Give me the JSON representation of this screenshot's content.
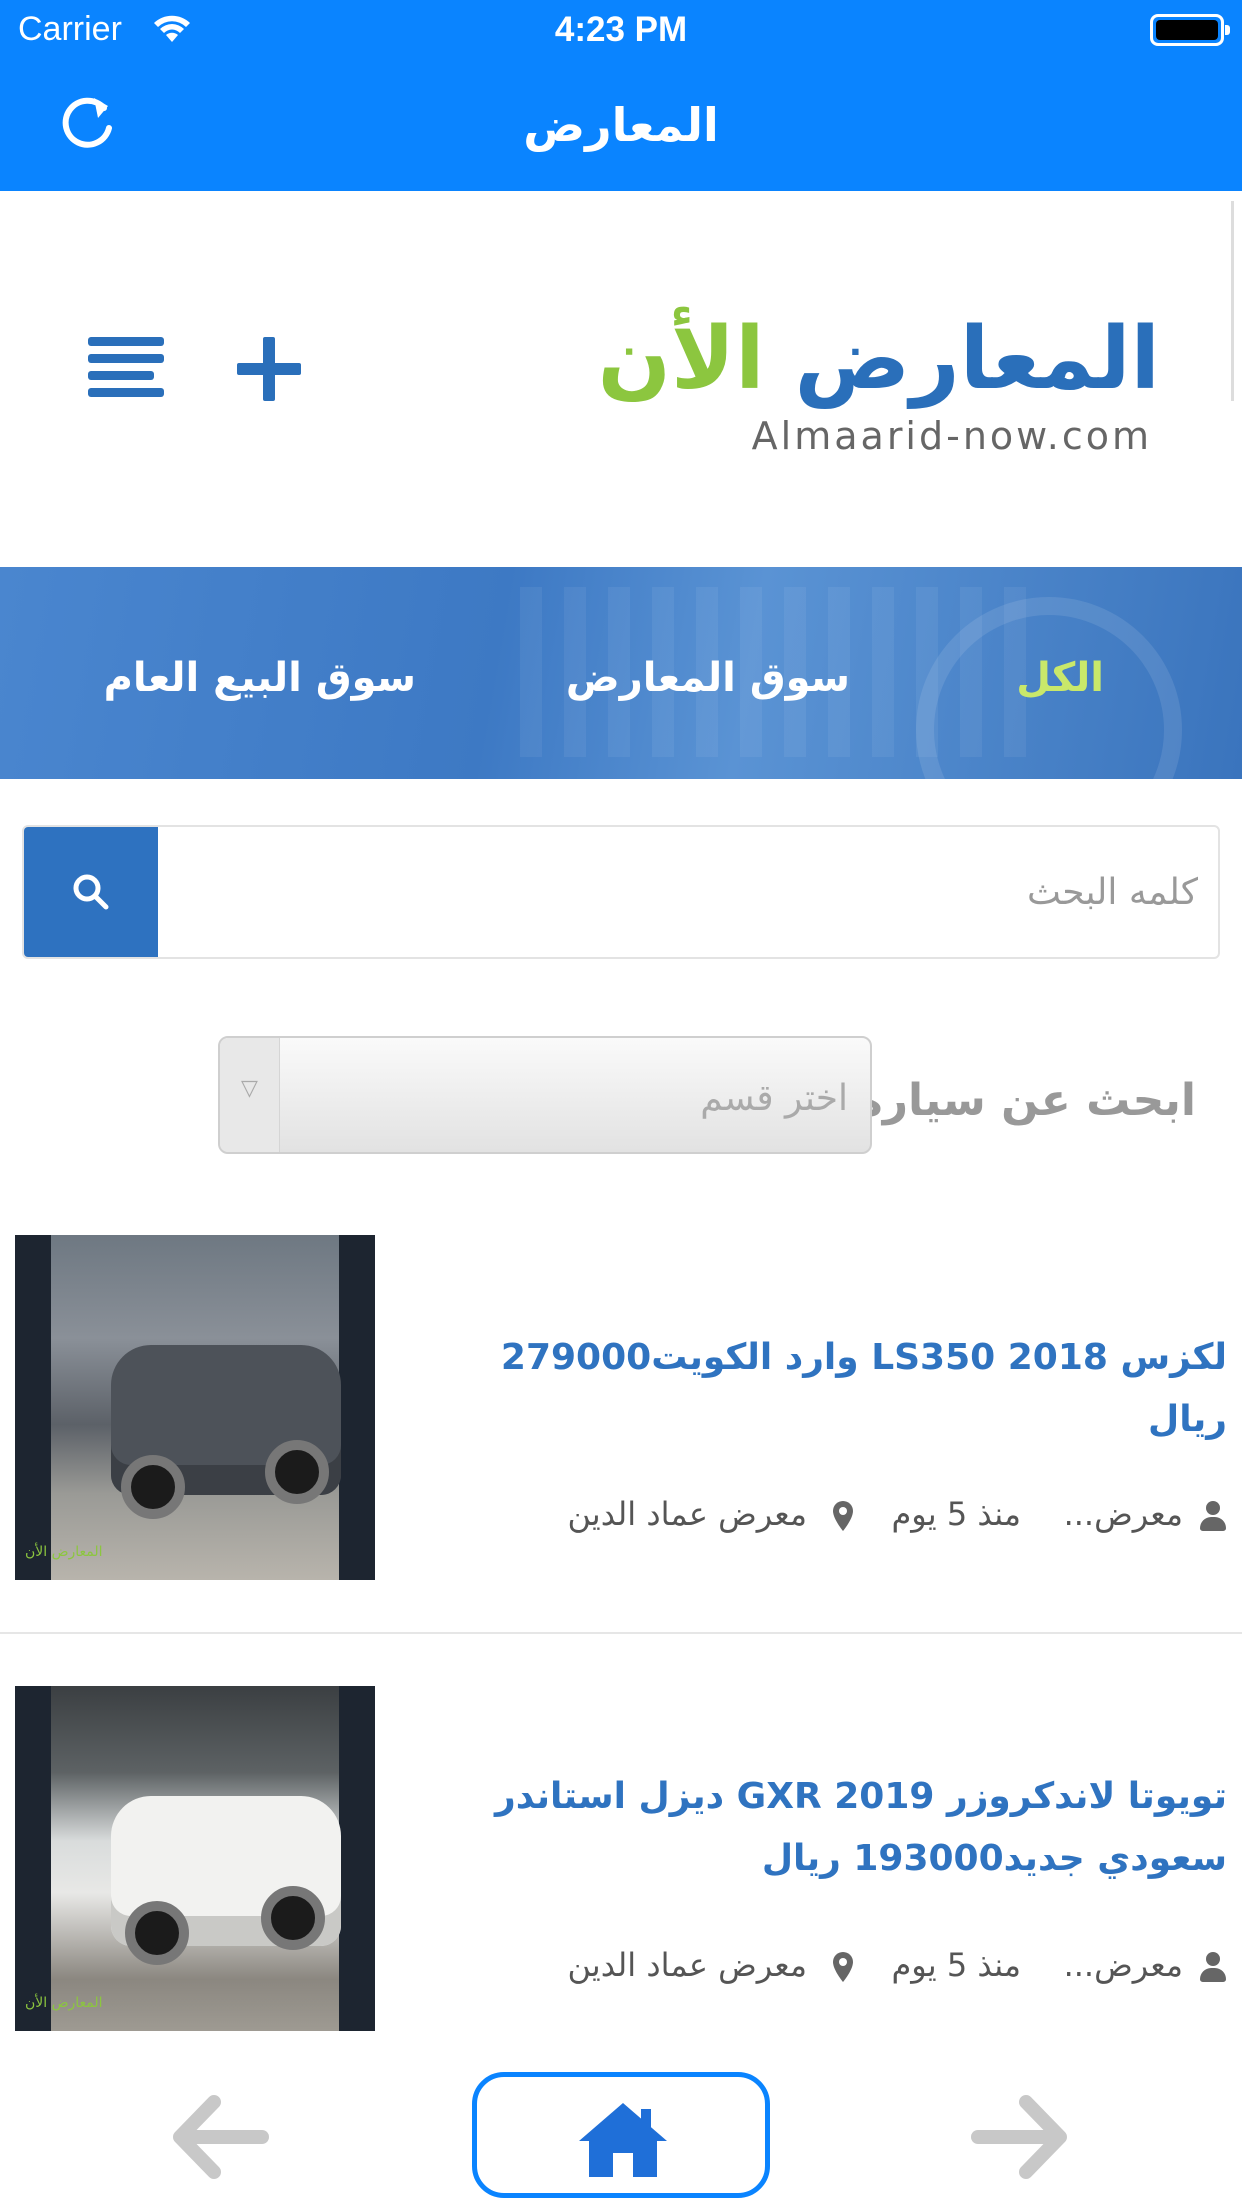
{
  "status_bar": {
    "carrier": "Carrier",
    "time": "4:23 PM"
  },
  "nav": {
    "title": "المعارض",
    "refresh_icon": "refresh-icon"
  },
  "header": {
    "logo_ar_green": "الأن",
    "logo_ar_blue": "المعارض",
    "logo_en": "Almaarid-now.com",
    "menu_icon": "menu-icon",
    "add_icon": "plus-icon"
  },
  "tabs": [
    {
      "label": "الكل",
      "active": true
    },
    {
      "label": "سوق المعارض",
      "active": false
    },
    {
      "label": "سوق البيع العام",
      "active": false
    }
  ],
  "search": {
    "placeholder": "كلمه البحث",
    "value": ""
  },
  "filter": {
    "label": "ابحث عن سيارة",
    "select_value": "اختر قسم"
  },
  "listings": [
    {
      "title": "لكزس LS350 2018 وارد الكويت279000 ريال",
      "owner": "معرض...",
      "time": "منذ 5 يوم",
      "showroom": "معرض عماد الدين",
      "watermark": "المعارض الأن"
    },
    {
      "title": "تويوتا لاندكروزر GXR 2019 ديزل استاندر سعودي جديد193000 ريال",
      "owner": "معرض...",
      "time": "منذ 5 يوم",
      "showroom": "معرض عماد الدين",
      "watermark": "المعارض الأن"
    }
  ],
  "colors": {
    "nav_blue": "#0a84ff",
    "brand_blue": "#2f73c0",
    "brand_green": "#8cc63f",
    "active_tab": "#c9e86a"
  }
}
